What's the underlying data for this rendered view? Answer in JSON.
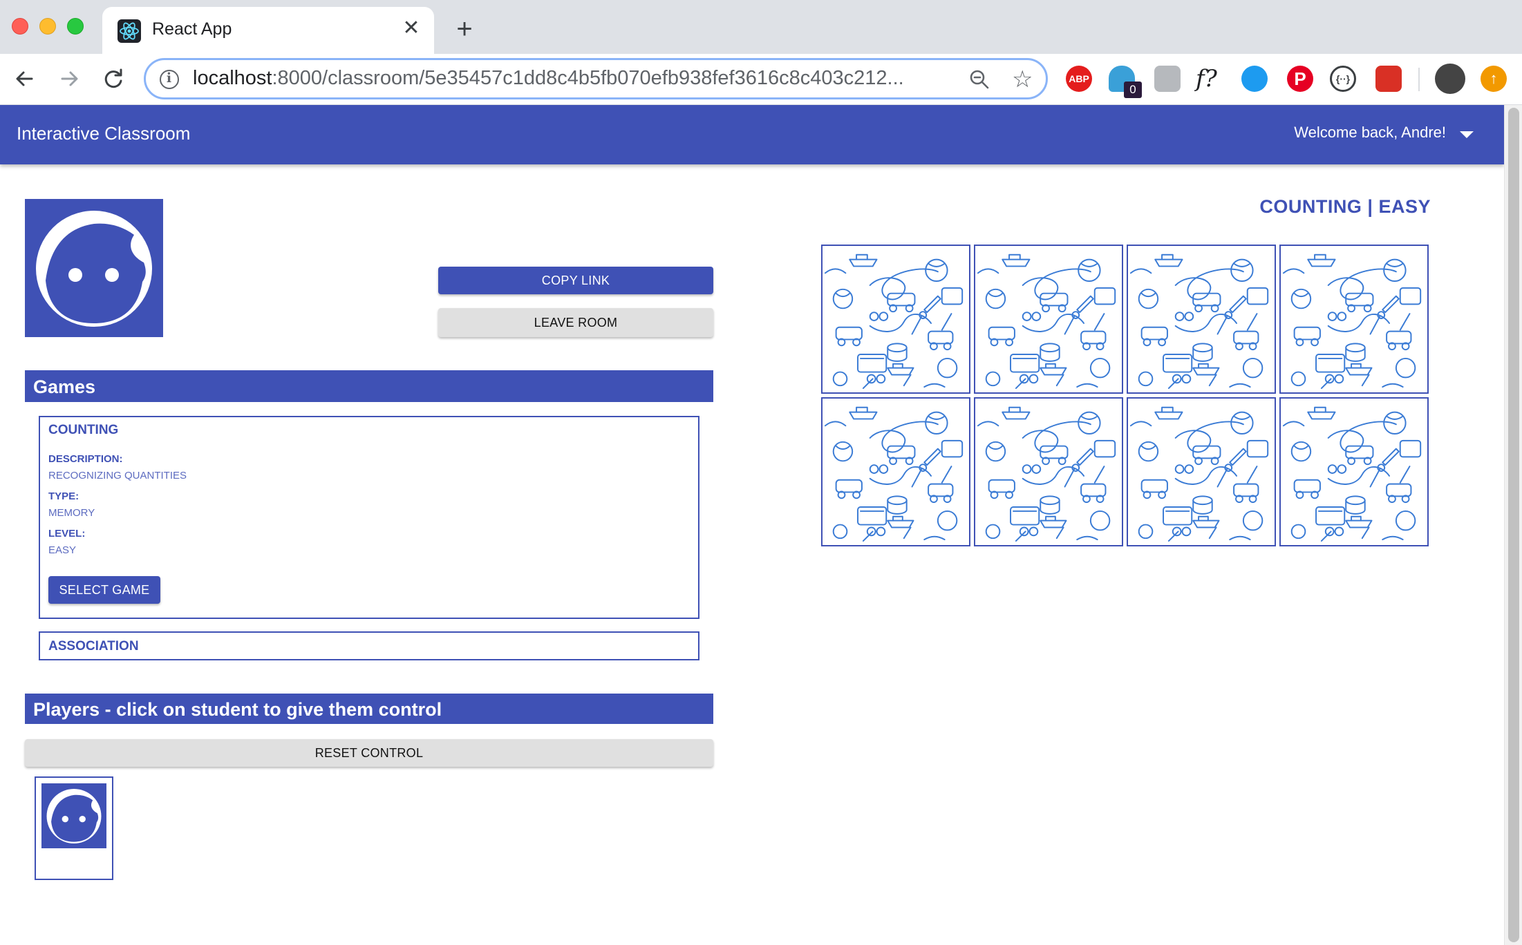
{
  "browser": {
    "tab_title": "React App",
    "url_host": "localhost",
    "url_rest": ":8000/classroom/5e35457c1dd8c4b5fb070efb938fef3616c8c403c212...",
    "extension_badge_count": "0",
    "extensions": [
      "ABP",
      "P"
    ]
  },
  "appbar": {
    "title": "Interactive Classroom",
    "welcome": "Welcome back, Andre!"
  },
  "room": {
    "copy_link": "COPY LINK",
    "leave_room": "LEAVE ROOM"
  },
  "games": {
    "heading": "Games",
    "cards": [
      {
        "title": "COUNTING",
        "description_label": "DESCRIPTION:",
        "description": "RECOGNIZING QUANTITIES",
        "type_label": "TYPE:",
        "type": "MEMORY",
        "level_label": "LEVEL:",
        "level": "EASY",
        "select_label": "SELECT GAME"
      },
      {
        "title": "ASSOCIATION"
      }
    ]
  },
  "players": {
    "heading": "Players - click on student to give them control",
    "reset_label": "RESET CONTROL"
  },
  "board": {
    "title": "COUNTING | EASY",
    "tile_count": 8,
    "tile_color": "#3a7bd5"
  },
  "colors": {
    "primary": "#3f51b5",
    "button_grey": "#e0e0e0"
  }
}
